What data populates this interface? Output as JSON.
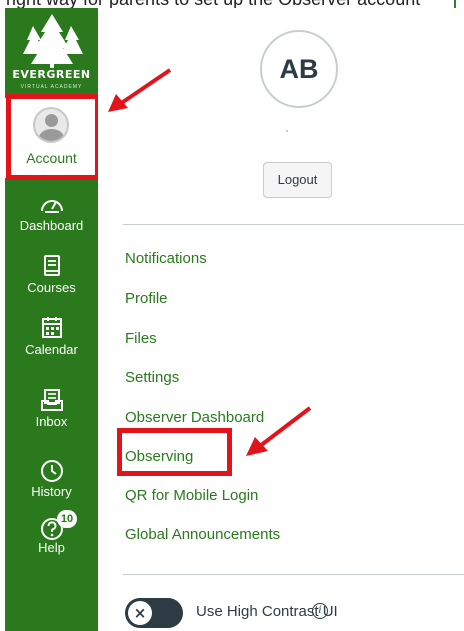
{
  "top_caption": "right way for parents to set up the Observer account",
  "school": {
    "name": "EVERGREEN",
    "subtitle": "VIRTUAL ACADEMY"
  },
  "global_nav": {
    "account": {
      "label": "Account",
      "icon": "avatar-icon"
    },
    "items": [
      {
        "label": "Dashboard",
        "icon": "speedometer-icon"
      },
      {
        "label": "Courses",
        "icon": "book-icon"
      },
      {
        "label": "Calendar",
        "icon": "calendar-icon"
      },
      {
        "label": "Inbox",
        "icon": "inbox-icon"
      },
      {
        "label": "History",
        "icon": "clock-icon"
      },
      {
        "label": "Help",
        "icon": "help-icon",
        "badge": "10"
      }
    ]
  },
  "account_tray": {
    "initials": "AB",
    "logout_label": "Logout",
    "links": [
      "Notifications",
      "Profile",
      "Files",
      "Settings",
      "Observer Dashboard",
      "Observing",
      "QR for Mobile Login",
      "Global Announcements"
    ],
    "high_contrast": {
      "label": "Use High Contrast UI",
      "state_glyph": "×",
      "info_glyph": "i"
    }
  },
  "colors": {
    "brand_green": "#2a7a1d",
    "highlight_red": "#e0141a",
    "text_dark": "#2d3b45"
  }
}
